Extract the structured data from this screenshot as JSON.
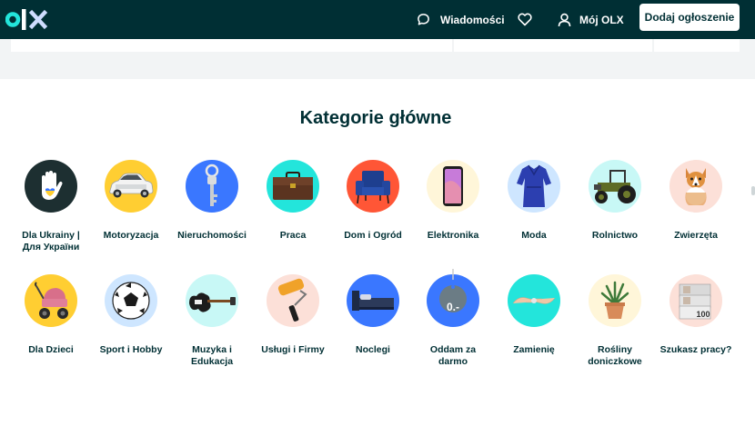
{
  "header": {
    "logo_text": "olx",
    "messages_label": "Wiadomości",
    "account_label": "Mój OLX",
    "post_button_label": "Dodaj ogłoszenie",
    "background": "#002f34"
  },
  "section": {
    "title": "Kategorie główne"
  },
  "categories": [
    {
      "label": "Dla Ukrainy |\nДля України",
      "icon": "ukraine-hand-icon",
      "circle_color": "#1d2f31"
    },
    {
      "label": "Motoryzacja",
      "icon": "car-icon",
      "circle_color": "#ffce32"
    },
    {
      "label": "Nieruchomości",
      "icon": "key-icon",
      "circle_color": "#3a77ff"
    },
    {
      "label": "Praca",
      "icon": "briefcase-icon",
      "circle_color": "#23e5db"
    },
    {
      "label": "Dom i Ogród",
      "icon": "armchair-icon",
      "circle_color": "#ff5636"
    },
    {
      "label": "Elektronika",
      "icon": "smartphone-icon",
      "circle_color": "#fff6d9"
    },
    {
      "label": "Moda",
      "icon": "dress-icon",
      "circle_color": "#cee6ff"
    },
    {
      "label": "Rolnictwo",
      "icon": "tractor-icon",
      "circle_color": "#c8f8f6"
    },
    {
      "label": "Zwierzęta",
      "icon": "dog-icon",
      "circle_color": "#fce0d8"
    },
    {
      "label": "Dla Dzieci",
      "icon": "stroller-icon",
      "circle_color": "#ffce32"
    },
    {
      "label": "Sport i Hobby",
      "icon": "football-icon",
      "circle_color": "#cee6ff"
    },
    {
      "label": "Muzyka i\nEdukacja",
      "icon": "guitar-icon",
      "circle_color": "#c8f8f6"
    },
    {
      "label": "Usługi i Firmy",
      "icon": "paint-roller-icon",
      "circle_color": "#fce0d8"
    },
    {
      "label": "Noclegi",
      "icon": "bed-icon",
      "circle_color": "#3a77ff"
    },
    {
      "label": "Oddam za\ndarmo",
      "icon": "price-tag-icon",
      "circle_color": "#3a77ff",
      "tag_text": "0.-"
    },
    {
      "label": "Zamienię",
      "icon": "exchange-hands-icon",
      "circle_color": "#23e5db"
    },
    {
      "label": "Rośliny\ndoniczkowe",
      "icon": "potted-plant-icon",
      "circle_color": "#fff6d9"
    },
    {
      "label": "Szukasz pracy?",
      "icon": "banknotes-icon",
      "circle_color": "#fce0d8",
      "note_text": "100"
    }
  ]
}
